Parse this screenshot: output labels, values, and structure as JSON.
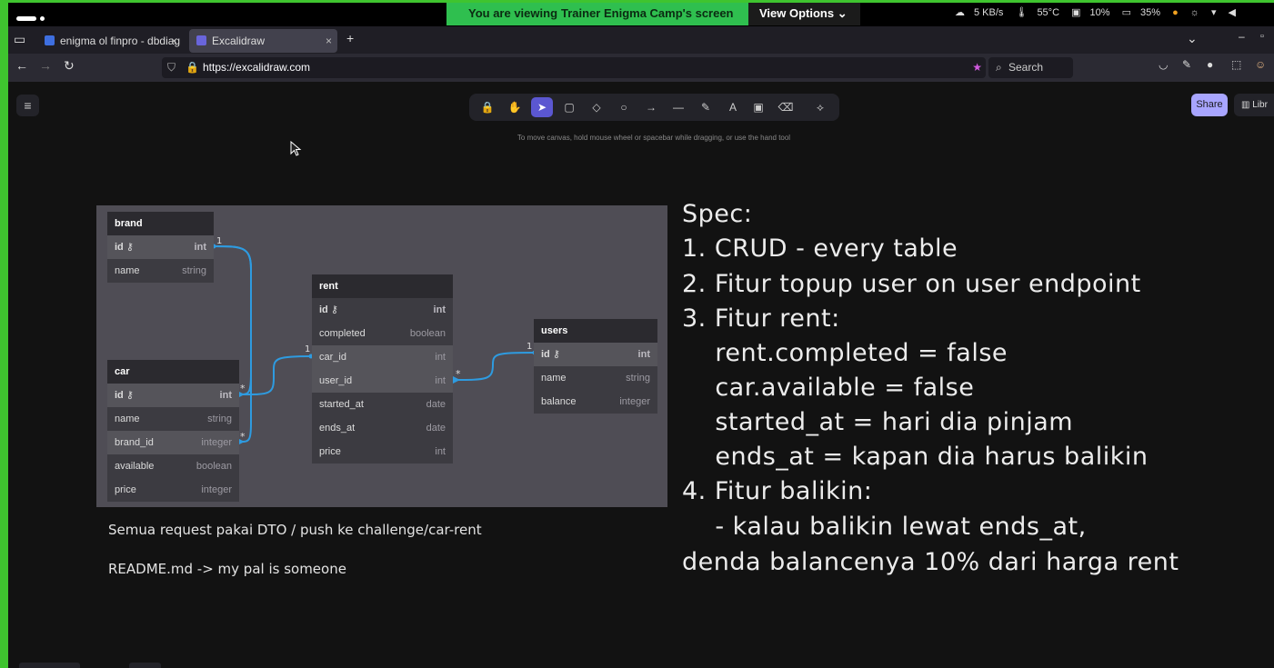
{
  "share_bar": {
    "viewing_prefix": "You are viewing",
    "presenter": "Trainer Enigma Camp's screen",
    "view_options": "View Options",
    "net_speed": "5 KB/s",
    "temperature": "55°C",
    "cpu": "10%",
    "memory": "35%"
  },
  "browser": {
    "tabs": [
      {
        "label": "enigma ol finpro - dbdiag",
        "active": false
      },
      {
        "label": "Excalidraw",
        "active": true
      }
    ],
    "url": "https://excalidraw.com",
    "search_placeholder": "Search"
  },
  "excalidraw": {
    "hint": "To move canvas, hold mouse wheel or spacebar while dragging, or use the hand tool",
    "share_label": "Share",
    "library_label": "Libr",
    "tools": [
      {
        "icon": "lock-icon",
        "glyph": "🔒",
        "key": ""
      },
      {
        "icon": "hand-icon",
        "glyph": "✋",
        "key": ""
      },
      {
        "icon": "selection-icon",
        "glyph": "➤",
        "key": "1"
      },
      {
        "icon": "rectangle-icon",
        "glyph": "▢",
        "key": "2"
      },
      {
        "icon": "diamond-icon",
        "glyph": "◇",
        "key": "3"
      },
      {
        "icon": "ellipse-icon",
        "glyph": "○",
        "key": "4"
      },
      {
        "icon": "arrow-icon",
        "glyph": "→",
        "key": "5"
      },
      {
        "icon": "line-icon",
        "glyph": "—",
        "key": "6"
      },
      {
        "icon": "pencil-icon",
        "glyph": "✎",
        "key": "7"
      },
      {
        "icon": "text-icon",
        "glyph": "A",
        "key": "8"
      },
      {
        "icon": "image-icon",
        "glyph": "▣",
        "key": "9"
      },
      {
        "icon": "eraser-icon",
        "glyph": "⌫",
        "key": "0"
      },
      {
        "icon": "ai-tools-icon",
        "glyph": "⟡",
        "key": ""
      }
    ]
  },
  "erd": {
    "brand": {
      "title": "brand",
      "rows": [
        {
          "name": "id",
          "type": "int"
        },
        {
          "name": "name",
          "type": "string"
        }
      ]
    },
    "car": {
      "title": "car",
      "rows": [
        {
          "name": "id",
          "type": "int"
        },
        {
          "name": "name",
          "type": "string"
        },
        {
          "name": "brand_id",
          "type": "integer"
        },
        {
          "name": "available",
          "type": "boolean"
        },
        {
          "name": "price",
          "type": "integer"
        }
      ]
    },
    "rent": {
      "title": "rent",
      "rows": [
        {
          "name": "id",
          "type": "int"
        },
        {
          "name": "completed",
          "type": "boolean"
        },
        {
          "name": "car_id",
          "type": "int"
        },
        {
          "name": "user_id",
          "type": "int"
        },
        {
          "name": "started_at",
          "type": "date"
        },
        {
          "name": "ends_at",
          "type": "date"
        },
        {
          "name": "price",
          "type": "int"
        }
      ]
    },
    "users": {
      "title": "users",
      "rows": [
        {
          "name": "id",
          "type": "int"
        },
        {
          "name": "name",
          "type": "string"
        },
        {
          "name": "balance",
          "type": "integer"
        }
      ]
    },
    "rel_one": "1",
    "rel_many": "*"
  },
  "notes": {
    "dto": "Semua request pakai DTO / push ke challenge/car-rent",
    "readme": "README.md -> my pal is someone"
  },
  "spec": {
    "lines": [
      "Spec:",
      "1. CRUD - every table",
      "2. Fitur topup user on user endpoint",
      "3. Fitur rent:",
      "    rent.completed = false",
      "    car.available = false",
      "    started_at = hari dia pinjam",
      "    ends_at = kapan dia harus balikin",
      "4. Fitur balikin:",
      "    - kalau balikin lewat ends_at,",
      "denda balancenya 10% dari harga rent"
    ]
  }
}
